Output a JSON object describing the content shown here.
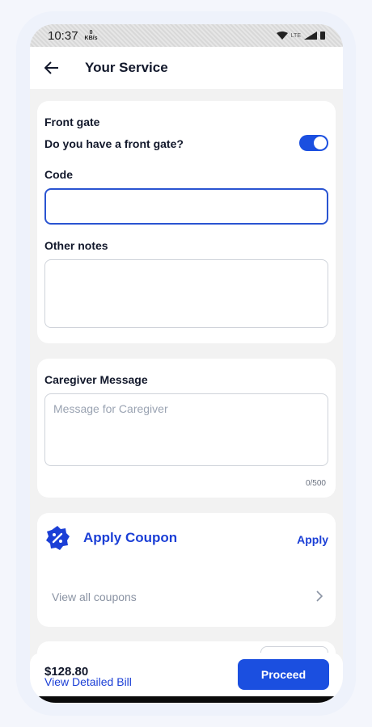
{
  "status_bar": {
    "time": "10:37",
    "speed_value": "0",
    "speed_unit": "KB/s",
    "network": "LTE"
  },
  "app_bar": {
    "title": "Your Service"
  },
  "front_gate": {
    "heading": "Front gate",
    "question": "Do you have a front gate?",
    "toggle_on": true,
    "code_label": "Code",
    "code_value": "",
    "notes_label": "Other notes",
    "notes_value": ""
  },
  "caregiver": {
    "heading": "Caregiver Message",
    "placeholder": "Message for Caregiver",
    "counter": "0/500"
  },
  "coupon": {
    "title": "Apply Coupon",
    "apply_label": "Apply",
    "view_all_label": "View all coupons"
  },
  "footer": {
    "price": "$128.80",
    "bill_link": "View Detailed Bill",
    "proceed_label": "Proceed"
  },
  "colors": {
    "accent": "#1b4fe0",
    "link": "#1b3fd6",
    "text": "#12182b"
  }
}
